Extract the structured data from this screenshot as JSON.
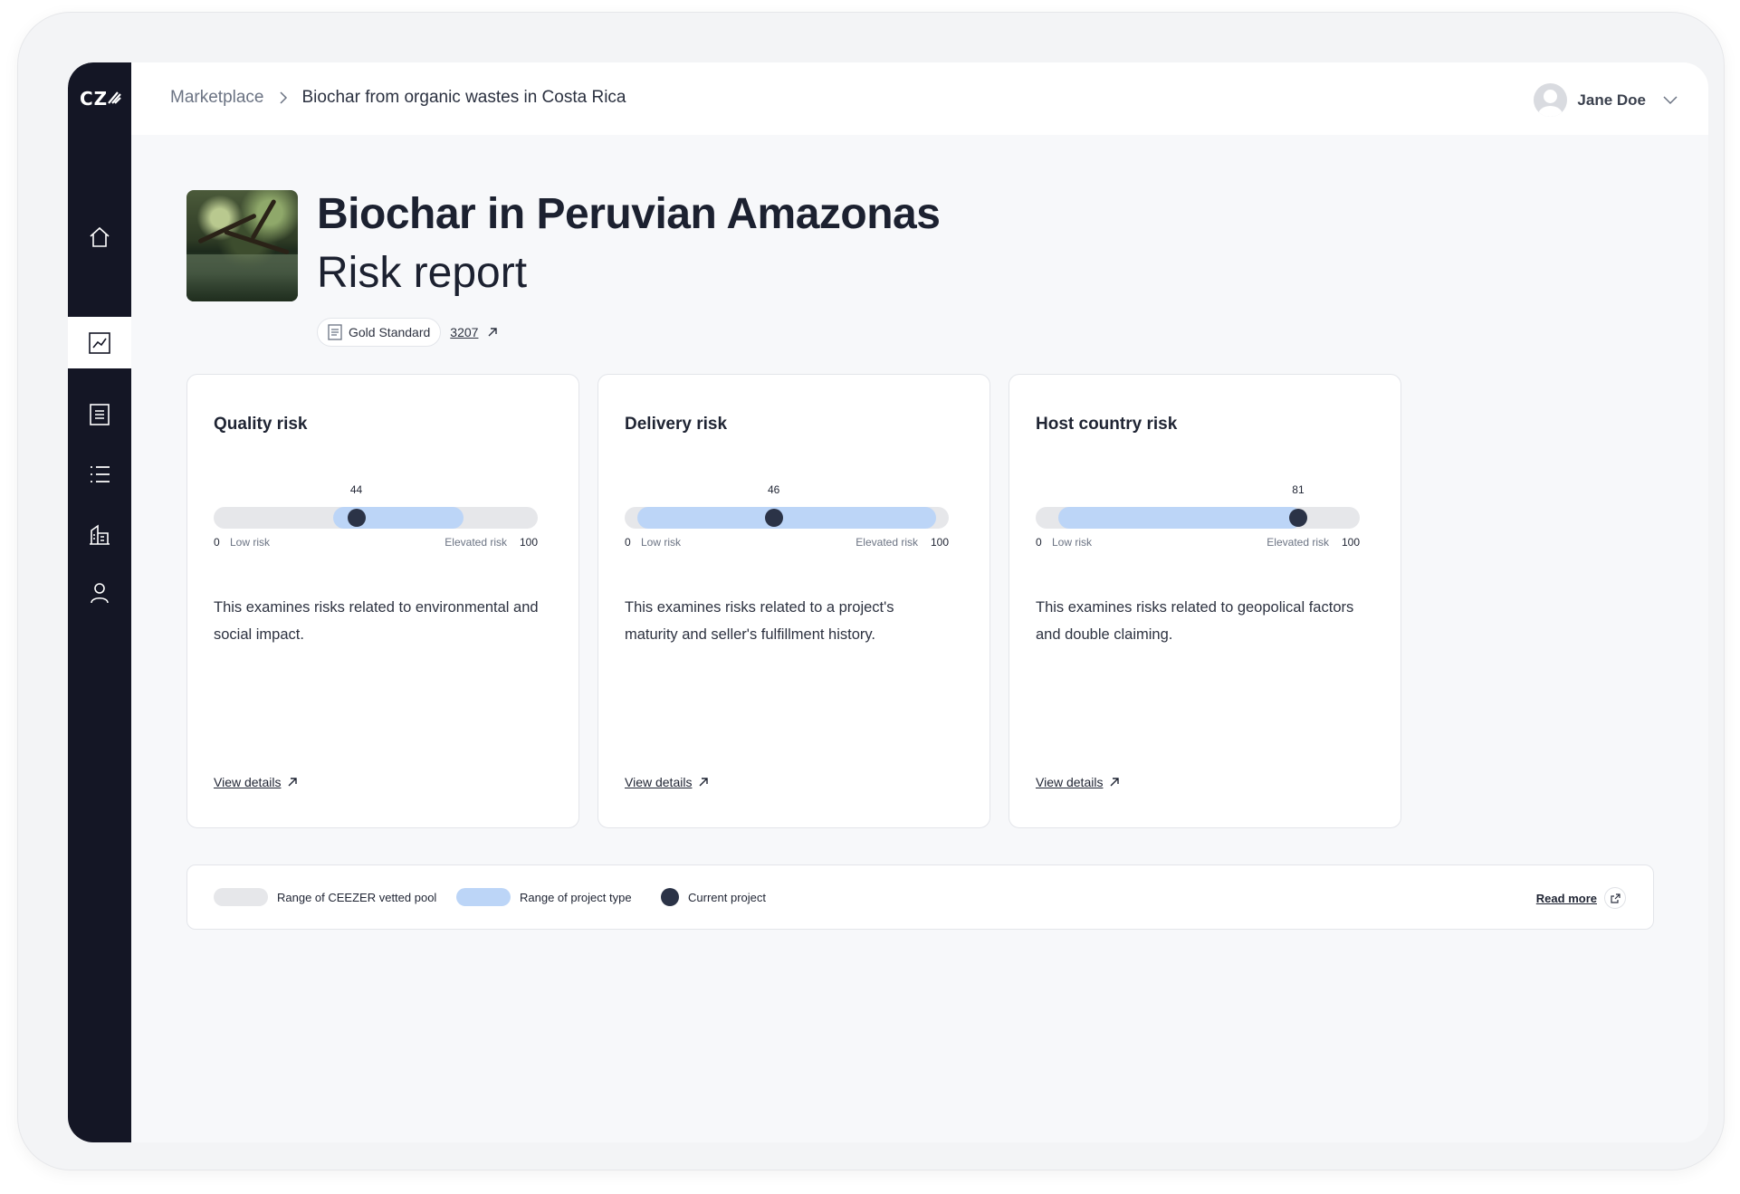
{
  "app": {
    "logo": "CZ"
  },
  "sidebar": {
    "items": [
      {
        "name": "home-icon",
        "active": false
      },
      {
        "name": "chart-icon",
        "active": true
      },
      {
        "name": "document-icon",
        "active": false
      },
      {
        "name": "list-icon",
        "active": false
      },
      {
        "name": "building-icon",
        "active": false
      },
      {
        "name": "user-icon",
        "active": false
      }
    ]
  },
  "header": {
    "breadcrumb": {
      "root": "Marketplace",
      "current": "Biochar from organic wastes in Costa Rica"
    },
    "user": {
      "name": "Jane Doe"
    }
  },
  "project": {
    "title": "Biochar in Peruvian Amazonas",
    "subtitle": "Risk report",
    "standard": "Gold Standard",
    "id": "3207"
  },
  "cards": [
    {
      "title": "Quality risk",
      "value": "44",
      "value_num": 44,
      "range": [
        37,
        77
      ],
      "scale_min": "0",
      "low_label": "Low risk",
      "high_label": "Elevated risk",
      "scale_max": "100",
      "description": "This examines risks related to environmental and social impact.",
      "details": "View details"
    },
    {
      "title": "Delivery risk",
      "value": "46",
      "value_num": 46,
      "range": [
        4,
        96
      ],
      "scale_min": "0",
      "low_label": "Low risk",
      "high_label": "Elevated risk",
      "scale_max": "100",
      "description": "This examines risks related to a project's maturity and seller's fulfillment history.",
      "details": "View details"
    },
    {
      "title": "Host country risk",
      "value": "81",
      "value_num": 81,
      "range": [
        7,
        82
      ],
      "scale_min": "0",
      "low_label": "Low risk",
      "high_label": "Elevated risk",
      "scale_max": "100",
      "description": "This examines risks related to geopolical factors and double claiming.",
      "details": "View details"
    }
  ],
  "legend": {
    "pool": "Range of CEEZER vetted pool",
    "type": "Range of project type",
    "current": "Current project",
    "read_more": "Read more"
  },
  "colors": {
    "sidebar_bg": "#141625",
    "pool_range": "#e6e7ea",
    "type_range": "#bcd5f7",
    "current_dot": "#2b3347"
  }
}
